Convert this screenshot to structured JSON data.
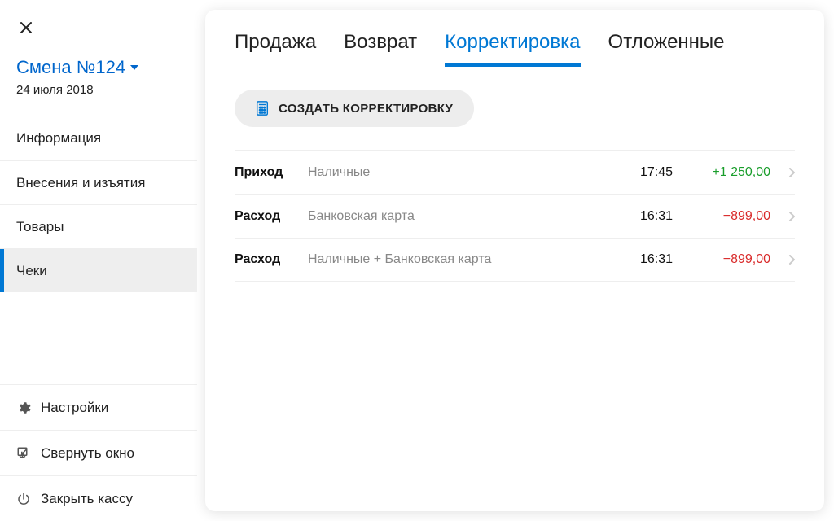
{
  "sidebar": {
    "shift_title": "Смена №124",
    "shift_date": "24 июля 2018",
    "nav": [
      {
        "label": "Информация",
        "active": false
      },
      {
        "label": "Внесения и изъятия",
        "active": false
      },
      {
        "label": "Товары",
        "active": false
      },
      {
        "label": "Чеки",
        "active": true
      }
    ],
    "utility": {
      "settings_label": "Настройки",
      "minimize_label": "Свернуть окно",
      "close_register_label": "Закрыть кассу"
    }
  },
  "main": {
    "tabs": [
      {
        "label": "Продажа",
        "active": false
      },
      {
        "label": "Возврат",
        "active": false
      },
      {
        "label": "Корректировка",
        "active": true
      },
      {
        "label": "Отложенные",
        "active": false
      }
    ],
    "create_button_label": "СОЗДАТЬ КОРРЕКТИРОВКУ",
    "rows": [
      {
        "type": "Приход",
        "method": "Наличные",
        "time": "17:45",
        "amount": "+1 250,00",
        "sign": "positive"
      },
      {
        "type": "Расход",
        "method": "Банковская карта",
        "time": "16:31",
        "amount": "−899,00",
        "sign": "negative"
      },
      {
        "type": "Расход",
        "method": "Наличные + Банковская карта",
        "time": "16:31",
        "amount": "−899,00",
        "sign": "negative"
      }
    ]
  }
}
